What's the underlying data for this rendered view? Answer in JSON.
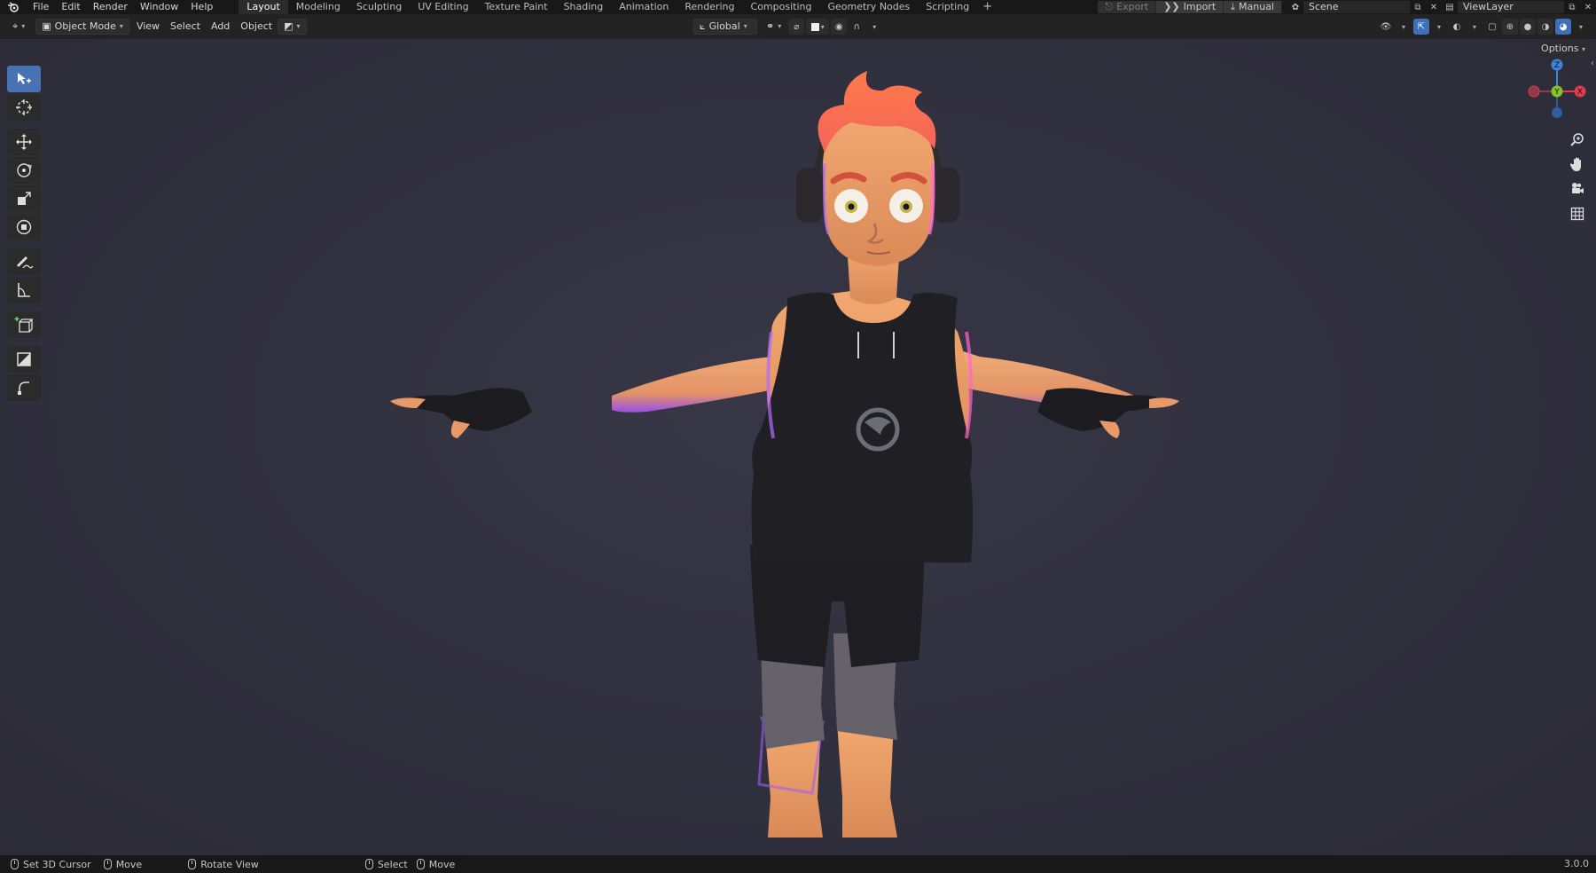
{
  "topbar": {
    "menu": [
      "File",
      "Edit",
      "Render",
      "Window",
      "Help"
    ],
    "workspaces": [
      "Layout",
      "Modeling",
      "Sculpting",
      "UV Editing",
      "Texture Paint",
      "Shading",
      "Animation",
      "Rendering",
      "Compositing",
      "Geometry Nodes",
      "Scripting"
    ],
    "active_workspace": "Layout",
    "add_workspace": "+",
    "export_label": "Export",
    "import_label": "Import",
    "manual_label": "Manual",
    "scene_name": "Scene",
    "view_layer_name": "ViewLayer"
  },
  "header": {
    "mode": "Object Mode",
    "menus": [
      "View",
      "Select",
      "Add",
      "Object"
    ],
    "transform_orientation": "Global"
  },
  "viewport": {
    "options_label": "Options",
    "axes": {
      "z": "Z",
      "y": "Y",
      "x": "X"
    },
    "colors": {
      "x": "#e23b4f",
      "y": "#86c328",
      "z": "#3f82da",
      "accent": "#4772b3"
    }
  },
  "toolbar": {
    "tools": [
      "select-box-icon",
      "cursor-icon",
      "move-icon",
      "rotate-icon",
      "scale-icon",
      "transform-icon",
      "annotate-icon",
      "measure-icon",
      "add-cube-icon",
      "extrude-icon",
      "spin-icon"
    ]
  },
  "statusbar": {
    "hint1": "Set 3D Cursor",
    "hint2": "Move",
    "hint3": "Rotate View",
    "hint4": "Select",
    "hint5": "Move",
    "version": "3.0.0"
  }
}
